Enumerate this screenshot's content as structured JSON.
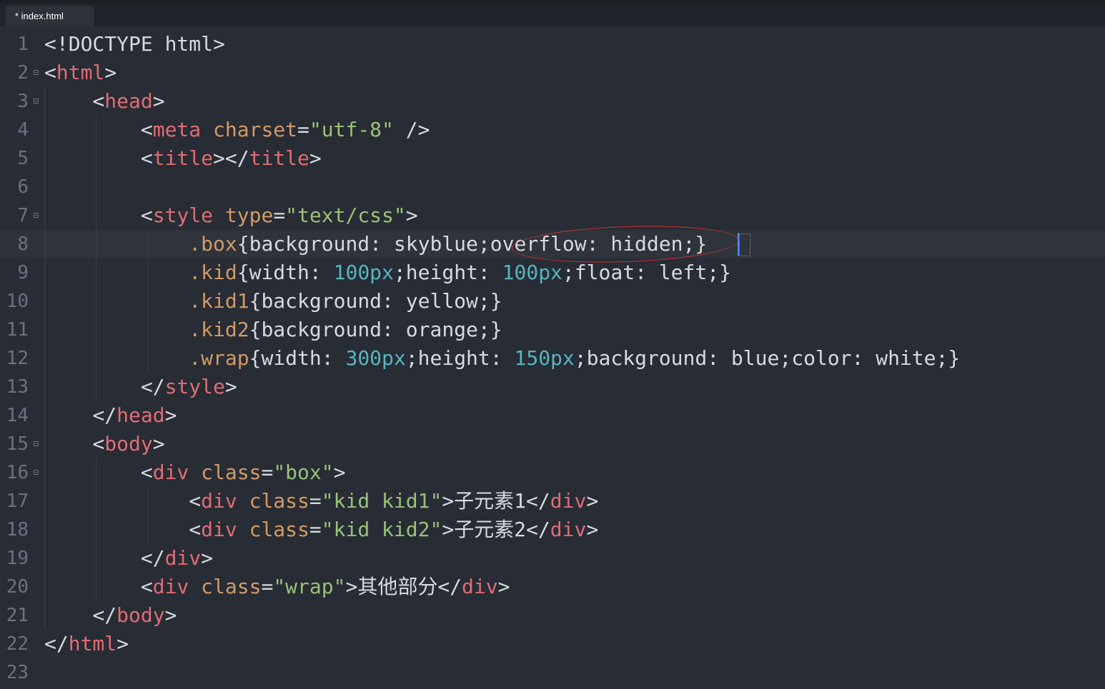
{
  "tab": {
    "label": "* index.html"
  },
  "lines": [
    {
      "n": "1",
      "fold": false,
      "current": false,
      "tokens": [
        [
          "t-punct",
          "<!DOCTYPE html>"
        ]
      ]
    },
    {
      "n": "2",
      "fold": true,
      "current": false,
      "tokens": [
        [
          "t-punct",
          "<"
        ],
        [
          "t-tag",
          "html"
        ],
        [
          "t-punct",
          ">"
        ]
      ]
    },
    {
      "n": "3",
      "fold": true,
      "current": false,
      "tokens": [
        [
          "t-punct",
          "    <"
        ],
        [
          "t-tag",
          "head"
        ],
        [
          "t-punct",
          ">"
        ]
      ]
    },
    {
      "n": "4",
      "fold": false,
      "current": false,
      "tokens": [
        [
          "t-punct",
          "        <"
        ],
        [
          "t-tag",
          "meta"
        ],
        [
          "t-punct",
          " "
        ],
        [
          "t-attr",
          "charset"
        ],
        [
          "t-punct",
          "="
        ],
        [
          "t-str",
          "\"utf-8\""
        ],
        [
          "t-punct",
          " />"
        ]
      ]
    },
    {
      "n": "5",
      "fold": false,
      "current": false,
      "tokens": [
        [
          "t-punct",
          "        <"
        ],
        [
          "t-tag",
          "title"
        ],
        [
          "t-punct",
          "></"
        ],
        [
          "t-tag",
          "title"
        ],
        [
          "t-punct",
          ">"
        ]
      ]
    },
    {
      "n": "6",
      "fold": false,
      "current": false,
      "tokens": [
        [
          "t-punct",
          ""
        ]
      ]
    },
    {
      "n": "7",
      "fold": true,
      "current": false,
      "tokens": [
        [
          "t-punct",
          "        <"
        ],
        [
          "t-tag",
          "style"
        ],
        [
          "t-punct",
          " "
        ],
        [
          "t-attr",
          "type"
        ],
        [
          "t-punct",
          "="
        ],
        [
          "t-str",
          "\"text/css\""
        ],
        [
          "t-punct",
          ">"
        ]
      ]
    },
    {
      "n": "8",
      "fold": false,
      "current": true,
      "tokens": [
        [
          "t-punct",
          "            "
        ],
        [
          "t-sel",
          ".box"
        ],
        [
          "t-punct",
          "{"
        ],
        [
          "t-prop",
          "background: skyblue;overflow: hidden;"
        ],
        [
          "t-punct",
          "}"
        ]
      ]
    },
    {
      "n": "9",
      "fold": false,
      "current": false,
      "tokens": [
        [
          "t-punct",
          "            "
        ],
        [
          "t-sel",
          ".kid"
        ],
        [
          "t-punct",
          "{"
        ],
        [
          "t-prop",
          "width: "
        ],
        [
          "t-num",
          "100px"
        ],
        [
          "t-prop",
          ";height: "
        ],
        [
          "t-num",
          "100px"
        ],
        [
          "t-prop",
          ";float: left;"
        ],
        [
          "t-punct",
          "}"
        ]
      ]
    },
    {
      "n": "10",
      "fold": false,
      "current": false,
      "tokens": [
        [
          "t-punct",
          "            "
        ],
        [
          "t-sel",
          ".kid1"
        ],
        [
          "t-punct",
          "{"
        ],
        [
          "t-prop",
          "background: yellow;"
        ],
        [
          "t-punct",
          "}"
        ]
      ]
    },
    {
      "n": "11",
      "fold": false,
      "current": false,
      "tokens": [
        [
          "t-punct",
          "            "
        ],
        [
          "t-sel",
          ".kid2"
        ],
        [
          "t-punct",
          "{"
        ],
        [
          "t-prop",
          "background: orange;"
        ],
        [
          "t-punct",
          "}"
        ]
      ]
    },
    {
      "n": "12",
      "fold": false,
      "current": false,
      "tokens": [
        [
          "t-punct",
          "            "
        ],
        [
          "t-sel",
          ".wrap"
        ],
        [
          "t-punct",
          "{"
        ],
        [
          "t-prop",
          "width: "
        ],
        [
          "t-num",
          "300px"
        ],
        [
          "t-prop",
          ";height: "
        ],
        [
          "t-num",
          "150px"
        ],
        [
          "t-prop",
          ";background: blue;color: white;"
        ],
        [
          "t-punct",
          "}"
        ]
      ]
    },
    {
      "n": "13",
      "fold": false,
      "current": false,
      "tokens": [
        [
          "t-punct",
          "        </"
        ],
        [
          "t-tag",
          "style"
        ],
        [
          "t-punct",
          ">"
        ]
      ]
    },
    {
      "n": "14",
      "fold": false,
      "current": false,
      "tokens": [
        [
          "t-punct",
          "    </"
        ],
        [
          "t-tag",
          "head"
        ],
        [
          "t-punct",
          ">"
        ]
      ]
    },
    {
      "n": "15",
      "fold": true,
      "current": false,
      "tokens": [
        [
          "t-punct",
          "    <"
        ],
        [
          "t-tag",
          "body"
        ],
        [
          "t-punct",
          ">"
        ]
      ]
    },
    {
      "n": "16",
      "fold": true,
      "current": false,
      "tokens": [
        [
          "t-punct",
          "        <"
        ],
        [
          "t-tag",
          "div"
        ],
        [
          "t-punct",
          " "
        ],
        [
          "t-attr",
          "class"
        ],
        [
          "t-punct",
          "="
        ],
        [
          "t-str",
          "\"box\""
        ],
        [
          "t-punct",
          ">"
        ]
      ]
    },
    {
      "n": "17",
      "fold": false,
      "current": false,
      "tokens": [
        [
          "t-punct",
          "            <"
        ],
        [
          "t-tag",
          "div"
        ],
        [
          "t-punct",
          " "
        ],
        [
          "t-attr",
          "class"
        ],
        [
          "t-punct",
          "="
        ],
        [
          "t-str",
          "\"kid kid1\""
        ],
        [
          "t-punct",
          ">子元素1</"
        ],
        [
          "t-tag",
          "div"
        ],
        [
          "t-punct",
          ">"
        ]
      ]
    },
    {
      "n": "18",
      "fold": false,
      "current": false,
      "tokens": [
        [
          "t-punct",
          "            <"
        ],
        [
          "t-tag",
          "div"
        ],
        [
          "t-punct",
          " "
        ],
        [
          "t-attr",
          "class"
        ],
        [
          "t-punct",
          "="
        ],
        [
          "t-str",
          "\"kid kid2\""
        ],
        [
          "t-punct",
          ">子元素2</"
        ],
        [
          "t-tag",
          "div"
        ],
        [
          "t-punct",
          ">"
        ]
      ]
    },
    {
      "n": "19",
      "fold": false,
      "current": false,
      "tokens": [
        [
          "t-punct",
          "        </"
        ],
        [
          "t-tag",
          "div"
        ],
        [
          "t-punct",
          ">"
        ]
      ]
    },
    {
      "n": "20",
      "fold": false,
      "current": false,
      "tokens": [
        [
          "t-punct",
          "        <"
        ],
        [
          "t-tag",
          "div"
        ],
        [
          "t-punct",
          " "
        ],
        [
          "t-attr",
          "class"
        ],
        [
          "t-punct",
          "="
        ],
        [
          "t-str",
          "\"wrap\""
        ],
        [
          "t-punct",
          ">其他部分</"
        ],
        [
          "t-tag",
          "div"
        ],
        [
          "t-punct",
          ">"
        ]
      ]
    },
    {
      "n": "21",
      "fold": false,
      "current": false,
      "tokens": [
        [
          "t-punct",
          "    </"
        ],
        [
          "t-tag",
          "body"
        ],
        [
          "t-punct",
          ">"
        ]
      ]
    },
    {
      "n": "22",
      "fold": false,
      "current": false,
      "tokens": [
        [
          "t-punct",
          "</"
        ],
        [
          "t-tag",
          "html"
        ],
        [
          "t-punct",
          ">"
        ]
      ]
    },
    {
      "n": "23",
      "fold": false,
      "current": false,
      "tokens": [
        [
          "t-punct",
          ""
        ]
      ]
    }
  ]
}
